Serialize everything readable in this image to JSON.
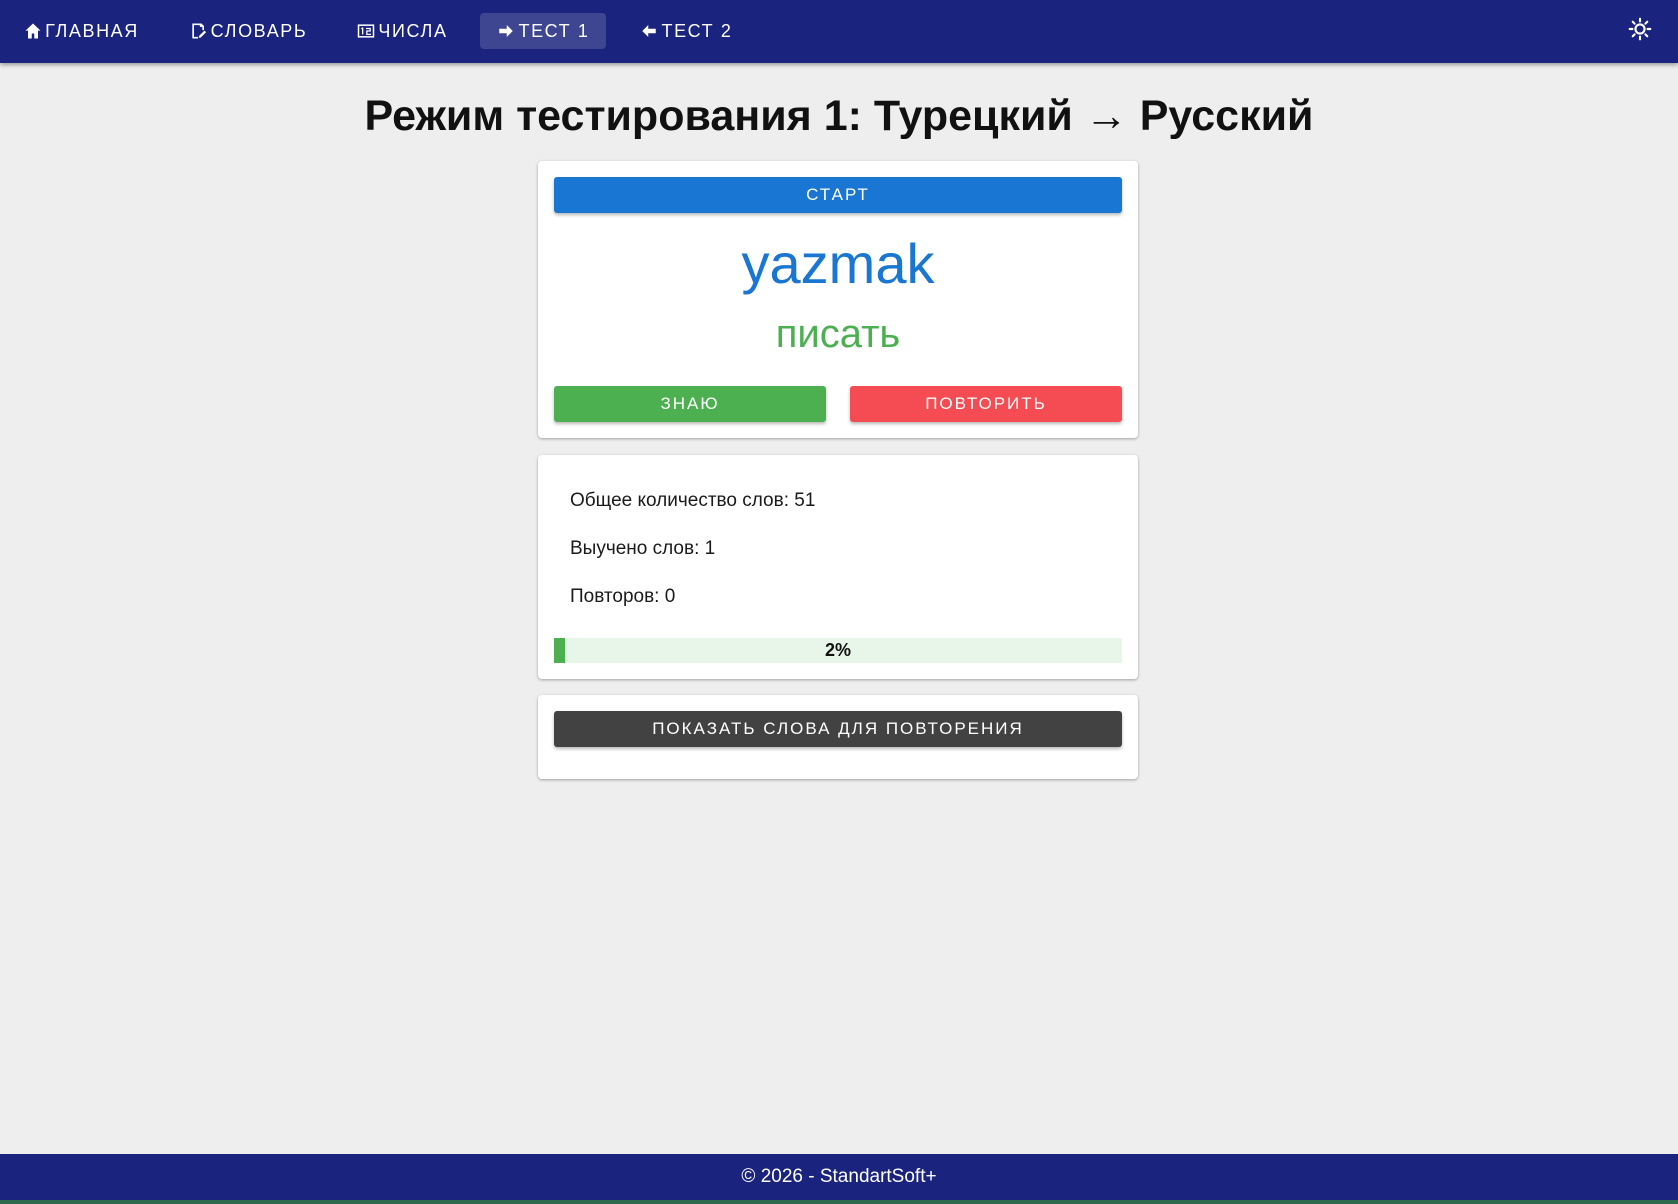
{
  "nav": {
    "items": [
      {
        "label": "ГЛАВНАЯ",
        "icon": "home-icon"
      },
      {
        "label": "СЛОВАРЬ",
        "icon": "dictionary-edit-icon"
      },
      {
        "label": "ЧИСЛА",
        "icon": "numbers-icon"
      },
      {
        "label": "ТЕСТ 1",
        "icon": "arrow-right-icon",
        "active": true
      },
      {
        "label": "ТЕСТ 2",
        "icon": "arrow-left-icon"
      }
    ],
    "settings_icon": "brightness-icon"
  },
  "page": {
    "title": "Режим тестирования 1: Турецкий → Русский"
  },
  "test_card": {
    "start_label": "СТАРТ",
    "word": "yazmak",
    "translation": "писать",
    "know_label": "ЗНАЮ",
    "repeat_label": "ПОВТОРИТЬ"
  },
  "stats": {
    "total_words": "Общее количество слов: 51",
    "learned_words": "Выучено слов: 1",
    "repeats": "Повторов: 0",
    "progress_percent": 2,
    "progress_label": "2%"
  },
  "review": {
    "show_label": "ПОКАЗАТЬ СЛОВА ДЛЯ ПОВТОРЕНИЯ"
  },
  "footer": {
    "text": "© 2026 - StandartSoft+"
  },
  "colors": {
    "nav_bg": "#1a237e",
    "primary": "#1976d2",
    "success": "#4caf50",
    "danger": "#f44c52",
    "dark": "#424242",
    "page_bg": "#eeeeee"
  }
}
